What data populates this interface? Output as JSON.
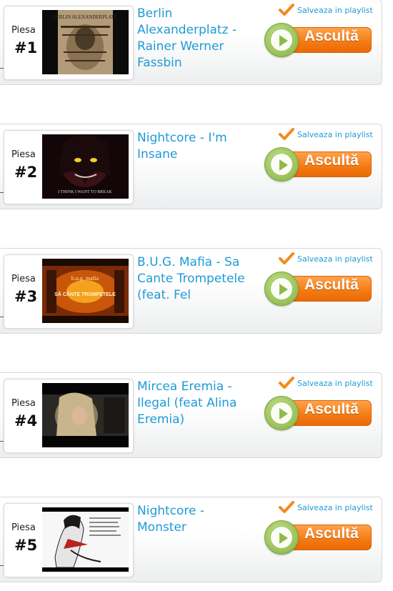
{
  "labels": {
    "piesa": "Piesa",
    "save": "Salveaza in playlist",
    "listen": "Ascultă"
  },
  "tracks": [
    {
      "rank": "#1",
      "title": "Berlin Alexanderplatz - Rainer Werner Fassbin",
      "thumb_text": "BERLIN ALEXANDERPLATZ"
    },
    {
      "rank": "#2",
      "title": "Nightcore - I'm Insane",
      "thumb_text": "I THINK I WANT TO BREAK"
    },
    {
      "rank": "#3",
      "title": "B.U.G. Mafia - Sa Cante Trompetele (feat. Fel",
      "thumb_text": "SĂ CÂNTE TROMPETELE"
    },
    {
      "rank": "#4",
      "title": "Mircea Eremia - Ilegal (feat Alina Eremia)",
      "thumb_text": ""
    },
    {
      "rank": "#5",
      "title": "Nightcore - Monster",
      "thumb_text": ""
    }
  ],
  "colors": {
    "title": "#1f9ad6",
    "listen_orange": "#f47a12",
    "play_green": "#8fba4a",
    "check_orange": "#f28a1c"
  },
  "icons": [
    "checkmark-icon",
    "play-icon"
  ]
}
